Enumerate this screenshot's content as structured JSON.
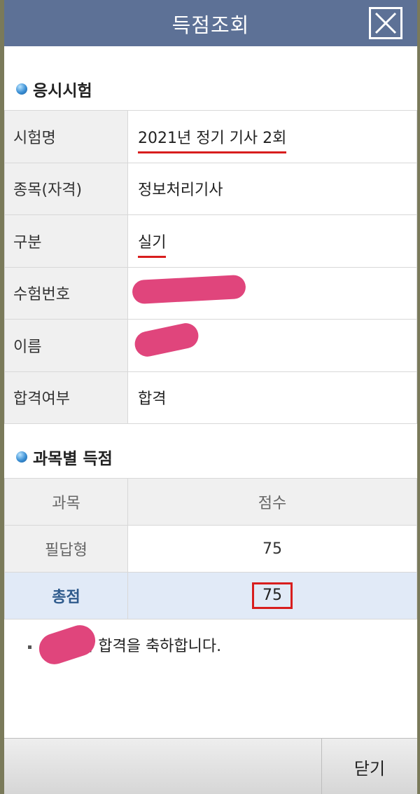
{
  "header": {
    "title": "득점조회",
    "close_icon": "close-x-icon"
  },
  "exam_section": {
    "title": "응시시험",
    "rows": [
      {
        "label": "시험명",
        "value": "2021년 정기 기사 2회"
      },
      {
        "label": "종목(자격)",
        "value": "정보처리기사"
      },
      {
        "label": "구분",
        "value": "실기"
      },
      {
        "label": "수험번호",
        "value": ""
      },
      {
        "label": "이름",
        "value": ""
      },
      {
        "label": "합격여부",
        "value": "합격"
      }
    ]
  },
  "score_section": {
    "title": "과목별 득점",
    "columns": [
      "과목",
      "점수"
    ],
    "rows": [
      {
        "subject": "필답형",
        "score": "75"
      }
    ],
    "total": {
      "label": "총점",
      "score": "75"
    }
  },
  "message": {
    "text": "님 합격을 축하합니다."
  },
  "footer": {
    "close_label": "닫기"
  },
  "colors": {
    "titlebar": "#5d7196",
    "accent_red": "#d81e1e",
    "redaction": "#e0457c",
    "total_row_bg": "#e1eaf7"
  }
}
